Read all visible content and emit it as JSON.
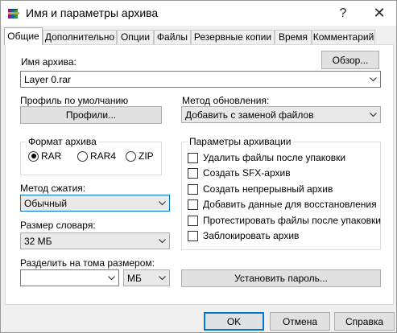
{
  "window": {
    "title": "Имя и параметры архива",
    "help_button": "?",
    "close_button": "✕"
  },
  "tabs": [
    {
      "label": "Общие",
      "active": true
    },
    {
      "label": "Дополнительно",
      "active": false
    },
    {
      "label": "Опции",
      "active": false
    },
    {
      "label": "Файлы",
      "active": false
    },
    {
      "label": "Резервные копии",
      "active": false
    },
    {
      "label": "Время",
      "active": false
    },
    {
      "label": "Комментарий",
      "active": false
    }
  ],
  "general": {
    "archive_name_label": "Имя архива:",
    "browse_button": "Обзор...",
    "archive_name_value": "Layer 0.rar",
    "profile_label": "Профиль по умолчанию",
    "profiles_button": "Профили...",
    "update_method_label": "Метод обновления:",
    "update_method_value": "Добавить с заменой файлов",
    "archive_format": {
      "label": "Формат архива",
      "options": [
        {
          "label": "RAR",
          "selected": true
        },
        {
          "label": "RAR4",
          "selected": false
        },
        {
          "label": "ZIP",
          "selected": false
        }
      ]
    },
    "compression_method_label": "Метод сжатия:",
    "compression_method_value": "Обычный",
    "dictionary_size_label": "Размер словаря:",
    "dictionary_size_value": "32 МБ",
    "split_label": "Разделить на тома размером:",
    "split_value": "",
    "split_unit_value": "МБ",
    "set_password_button": "Установить пароль...",
    "archiving_options": {
      "label": "Параметры архивации",
      "items": [
        {
          "label": "Удалить файлы после упаковки",
          "checked": false
        },
        {
          "label": "Создать SFX-архив",
          "checked": false
        },
        {
          "label": "Создать непрерывный архив",
          "checked": false
        },
        {
          "label": "Добавить данные для восстановления",
          "checked": false
        },
        {
          "label": "Протестировать файлы после упаковки",
          "checked": false
        },
        {
          "label": "Заблокировать архив",
          "checked": false
        }
      ]
    }
  },
  "footer": {
    "ok_button": "OK",
    "cancel_button": "Отмена",
    "help_button": "Справка"
  },
  "colors": {
    "accent": "#0078d7",
    "panel_bg": "#ffffff",
    "window_bg": "#f0f0f0"
  },
  "icons": {
    "app": "winrar-books-icon",
    "dropdown": "chevron-down-icon"
  }
}
